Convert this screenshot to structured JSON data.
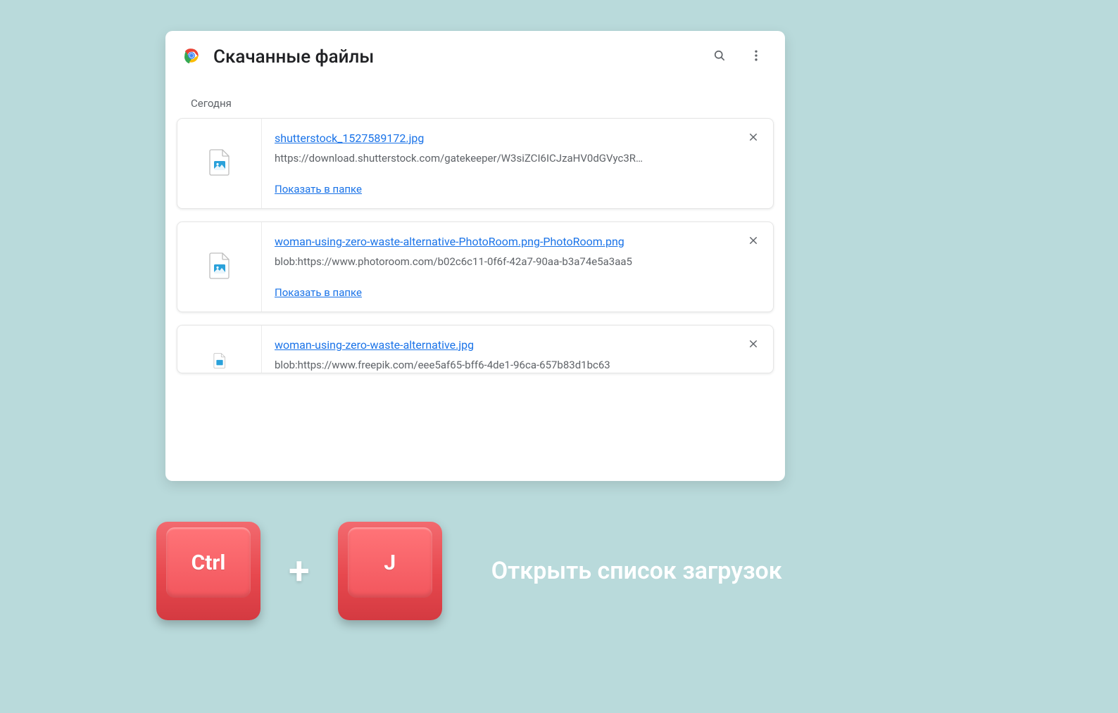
{
  "header": {
    "title": "Скачанные файлы"
  },
  "section_label": "Сегодня",
  "downloads": [
    {
      "filename": "shutterstock_1527589172.jpg",
      "url": "https://download.shutterstock.com/gatekeeper/W3siZCI6ICJzaHV0dGVyc3R…",
      "show_in_folder": "Показать в папке"
    },
    {
      "filename": "woman-using-zero-waste-alternative-PhotoRoom.png-PhotoRoom.png",
      "url": "blob:https://www.photoroom.com/b02c6c11-0f6f-42a7-90aa-b3a74e5a3aa5",
      "show_in_folder": "Показать в папке"
    },
    {
      "filename": "woman-using-zero-waste-alternative.jpg",
      "url": "blob:https://www.freepik.com/eee5af65-bff6-4de1-96ca-657b83d1bc63",
      "show_in_folder": ""
    }
  ],
  "shortcut": {
    "key1": "Ctrl",
    "plus": "+",
    "key2": "J",
    "caption": "Открыть список загрузок"
  }
}
